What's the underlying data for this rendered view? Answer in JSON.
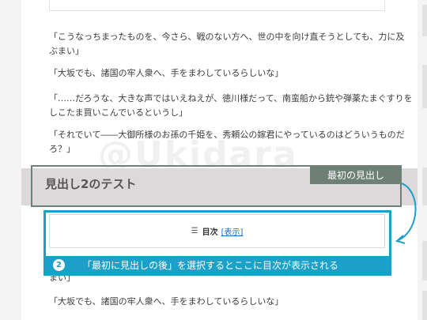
{
  "paragraphs_top": [
    "「こうなっちまったものを、今さら、戦のない方へ、世の中を向け直そうとしても、力に及ぶまい」",
    "「大坂でも、諸国の牢人衆へ、手をまわしているらしいな」",
    "「……だろうな、大きな声ではいえねえが、徳川様だって、南蛮船から銃や弾薬たまぐすりをしこたま買いこんでいるというし」",
    "「それでいて――大御所様のお孫の千姫を、秀頼公の嫁君にやっているのはどういうものだろ？」"
  ],
  "watermark": "@Ukidara",
  "heading": {
    "text": "見出し2のテスト",
    "annotation": "最初の見出し"
  },
  "toc": {
    "icon": "list-icon",
    "title": "目次",
    "toggle": "[表示]"
  },
  "caption": {
    "step": "2",
    "text": "「最初に見出しの後」を選択するとここに目次が表示される"
  },
  "paragraphs_bottom": [
    "まい」",
    "「大坂でも、諸国の牢人衆へ、手をまわしているらしいな」"
  ],
  "colors": {
    "annotation_gray": "#6e7f76",
    "highlight_blue": "#1aa0c9",
    "heading_band": "#ddd8d9",
    "link": "#1d6ac8"
  }
}
